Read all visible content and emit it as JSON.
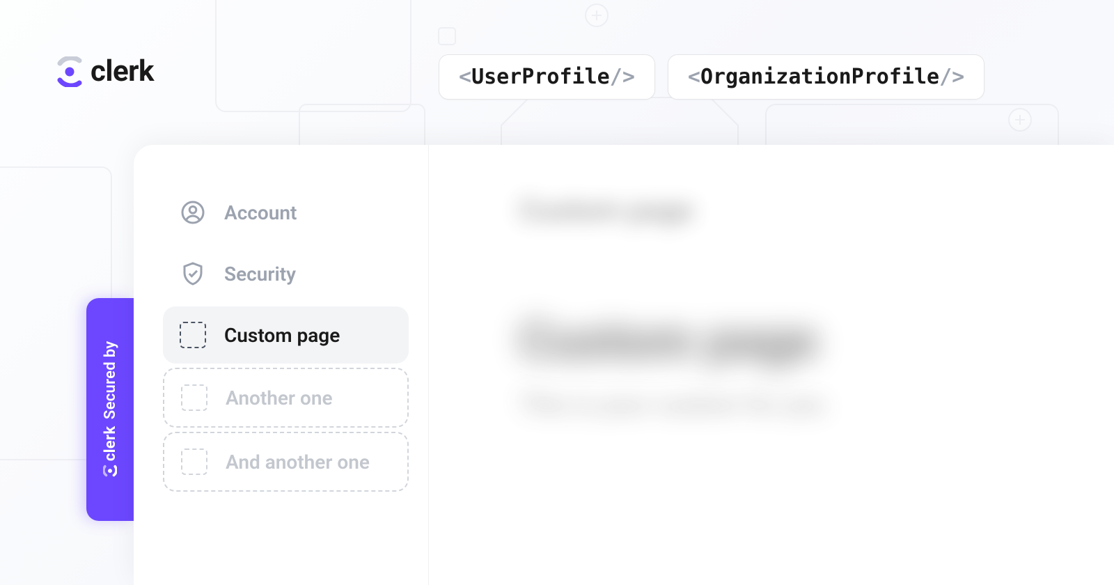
{
  "brand": {
    "name": "clerk"
  },
  "components": {
    "user_profile": "UserProfile",
    "org_profile": "OrganizationProfile"
  },
  "secured_by": {
    "prefix": "Secured by",
    "brand": "clerk"
  },
  "sidebar": {
    "items": [
      {
        "label": "Account"
      },
      {
        "label": "Security"
      },
      {
        "label": "Custom page"
      },
      {
        "label": "Another one"
      },
      {
        "label": "And another one"
      }
    ]
  },
  "content": {
    "small_heading": "Custom page",
    "large_heading": "Custom page",
    "subtitle": "This is your custom for you"
  }
}
